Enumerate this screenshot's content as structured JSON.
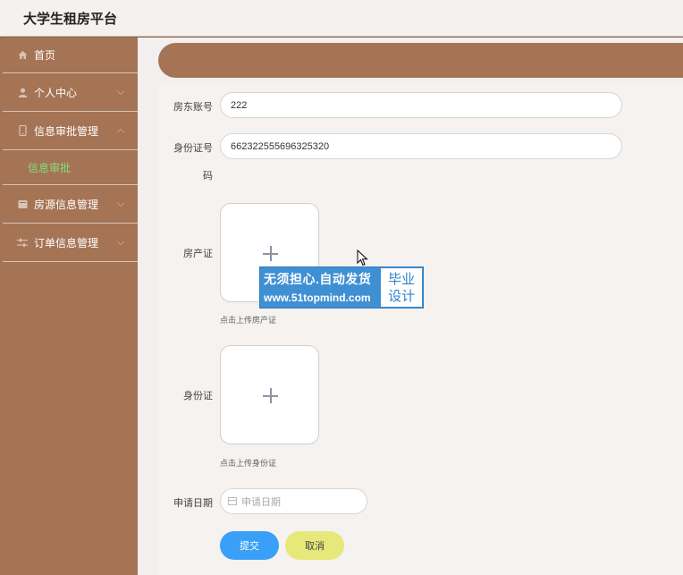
{
  "app": {
    "title": "大学生租房平台"
  },
  "sidebar": {
    "items": [
      {
        "label": "首页",
        "icon": "home-icon"
      },
      {
        "label": "个人中心",
        "icon": "user-icon"
      },
      {
        "label": "信息审批管理",
        "icon": "phone-icon"
      },
      {
        "label": "房源信息管理",
        "icon": "folder-icon"
      },
      {
        "label": "订单信息管理",
        "icon": "sliders-icon"
      }
    ],
    "active_sub": {
      "label": "信息审批"
    }
  },
  "form": {
    "landlord_account": {
      "label": "房东账号",
      "value": "222"
    },
    "id_number": {
      "label_line1": "身份证号",
      "label_line2": "码",
      "value": "662322555696325320"
    },
    "property_cert": {
      "label": "房产证",
      "hint": "点击上传房产证"
    },
    "id_card": {
      "label": "身份证",
      "hint": "点击上传身份证"
    },
    "apply_date": {
      "label": "申请日期",
      "placeholder": "申请日期"
    },
    "submit_label": "提交",
    "cancel_label": "取消"
  },
  "watermark": {
    "line1": "无须担心.自动发货",
    "line2": "www.51topmind.com",
    "badge_line1": "毕业",
    "badge_line2": "设计"
  },
  "colors": {
    "sidebar_bg": "#a57455",
    "sub_active": "#7fe07a",
    "submit": "#3aa0f7",
    "cancel": "#e6e97a"
  }
}
